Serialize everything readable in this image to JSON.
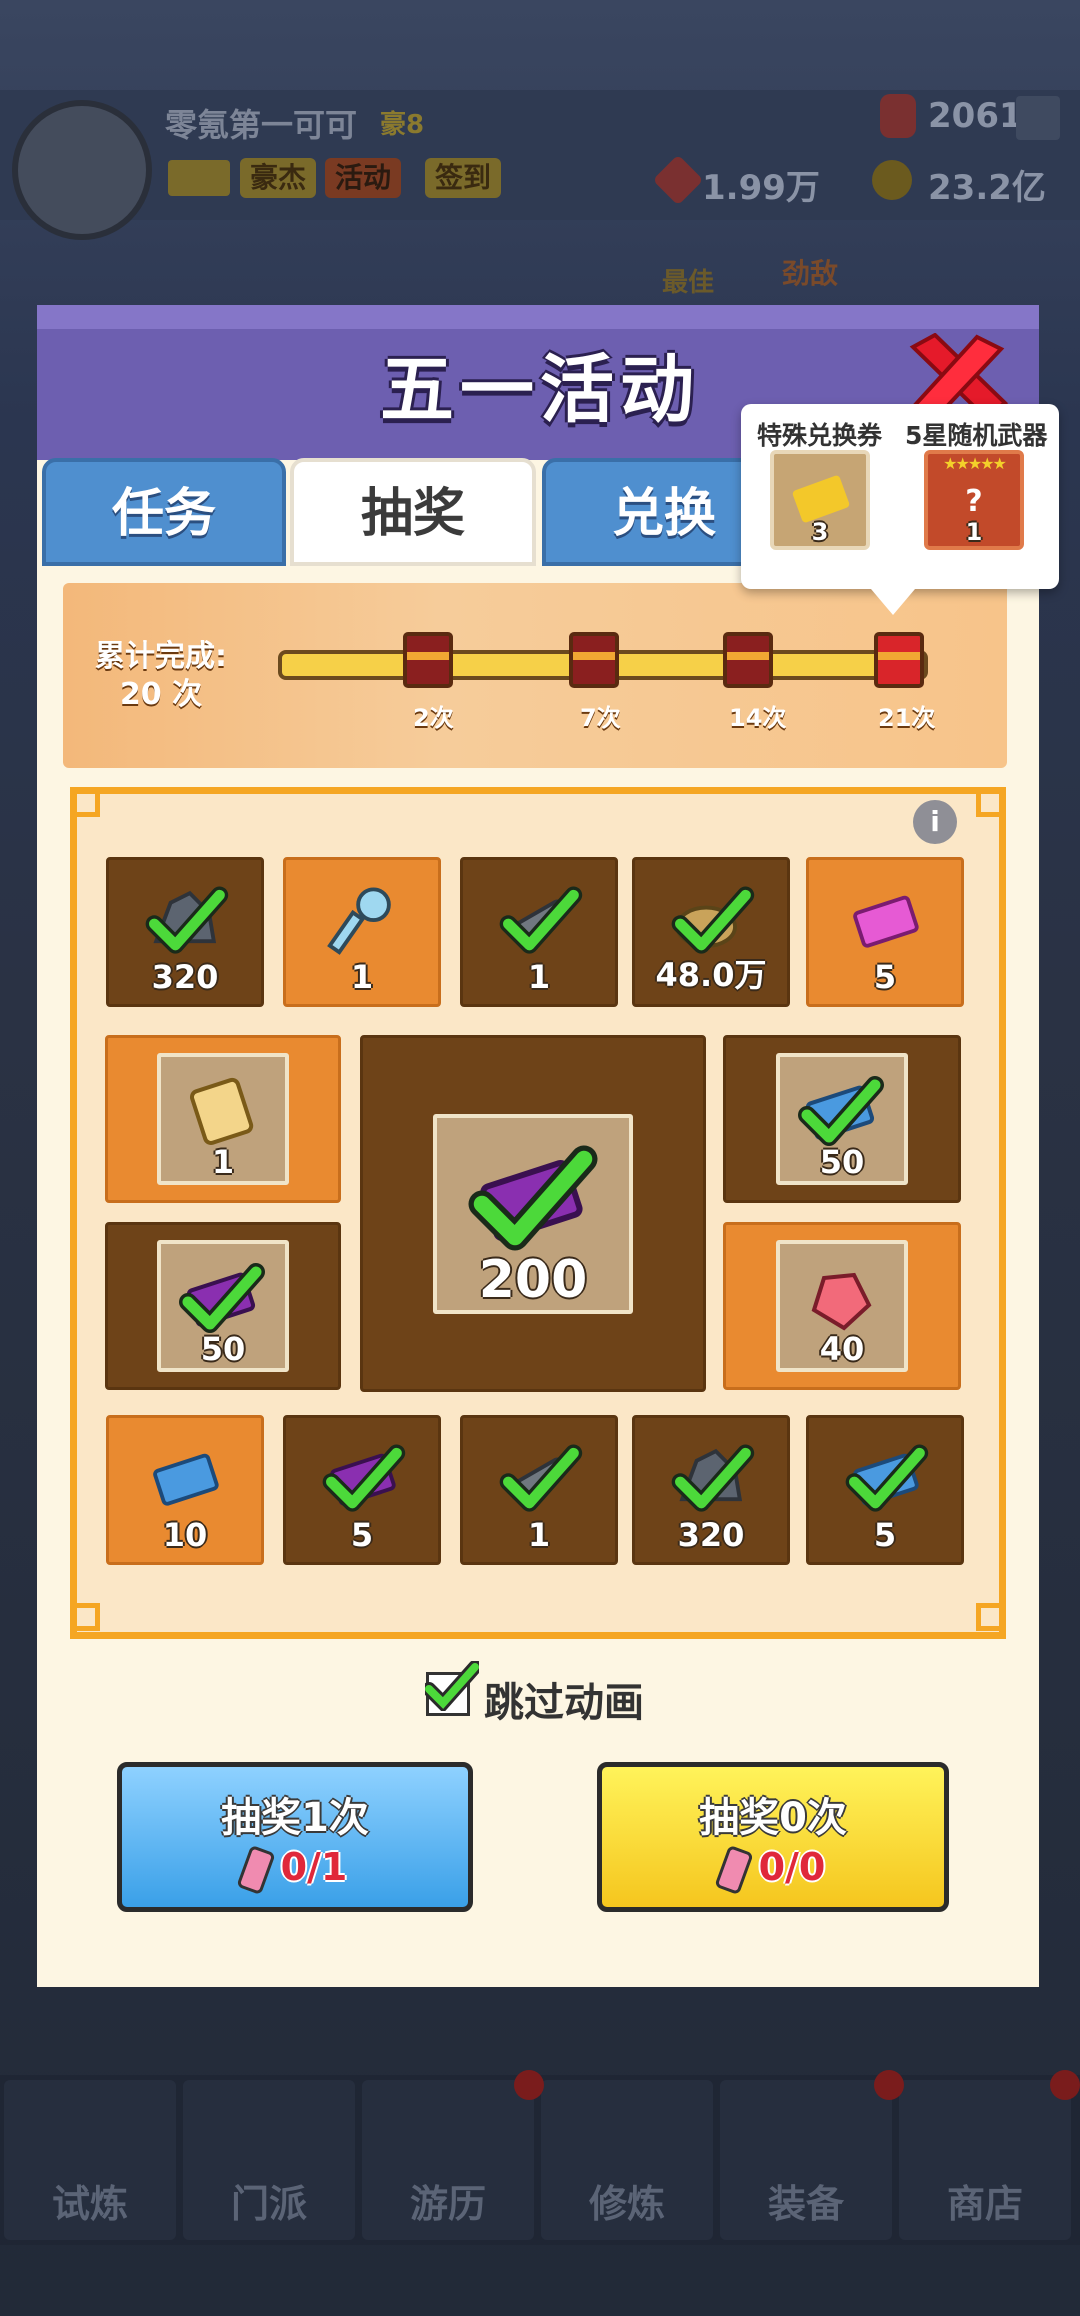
{
  "background": {
    "player_name": "零氪第一可可",
    "vip_badge": "豪8",
    "buttons": [
      "豪杰",
      "活动",
      "签到"
    ],
    "gems": "2061",
    "currency_a": "1.99万",
    "gold": "23.2亿",
    "side_labels": [
      "最佳",
      "劲敌"
    ],
    "nav": [
      "试炼",
      "门派",
      "游历",
      "修炼",
      "装备",
      "商店"
    ]
  },
  "panel": {
    "title": "五一活动",
    "tabs": [
      "任务",
      "抽奖",
      "兑换"
    ],
    "active_tab": "抽奖",
    "progress": {
      "label_line1": "累计完成:",
      "label_line2": "20 次",
      "completed": 20,
      "milestones": [
        "2次",
        "7次",
        "14次",
        "21次"
      ]
    },
    "tooltip": {
      "item1_label": "特殊兑换券",
      "item1_count": "3",
      "item2_label": "5星随机武器",
      "item2_count": "1",
      "stars": "★★★★★"
    },
    "info_glyph": "i",
    "rewards": [
      {
        "qty": "320",
        "item": "ore",
        "claimed": true
      },
      {
        "qty": "1",
        "item": "key",
        "claimed": false
      },
      {
        "qty": "1",
        "item": "gun",
        "claimed": true
      },
      {
        "qty": "48.0万",
        "item": "coins",
        "claimed": true
      },
      {
        "qty": "5",
        "item": "pink-ticket",
        "claimed": false
      },
      {
        "qty": "1",
        "item": "scroll",
        "claimed": false
      },
      {
        "qty": "200",
        "item": "purple-ticket",
        "claimed": true
      },
      {
        "qty": "50",
        "item": "blue-ticket",
        "claimed": true
      },
      {
        "qty": "50",
        "item": "purple-ticket",
        "claimed": true
      },
      {
        "qty": "40",
        "item": "red-gem",
        "claimed": false
      },
      {
        "qty": "10",
        "item": "blue-ticket",
        "claimed": false
      },
      {
        "qty": "5",
        "item": "purple-ticket",
        "claimed": true
      },
      {
        "qty": "1",
        "item": "gun",
        "claimed": true
      },
      {
        "qty": "320",
        "item": "ore",
        "claimed": true
      },
      {
        "qty": "5",
        "item": "blue-ticket",
        "claimed": true
      }
    ],
    "skip_animation": "跳过动画",
    "draw1": {
      "label": "抽奖1次",
      "cost": "0/1"
    },
    "draw0": {
      "label": "抽奖0次",
      "cost": "0/0"
    }
  }
}
